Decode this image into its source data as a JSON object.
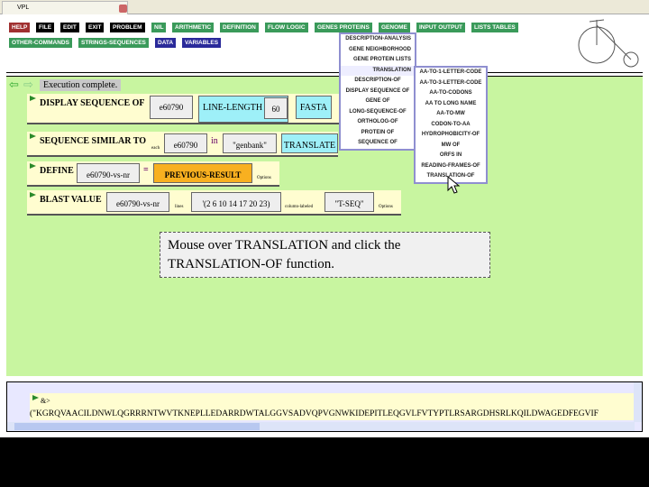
{
  "window": {
    "title": "VPL"
  },
  "toolbar": {
    "row1": [
      {
        "label": "HELP",
        "color": "#a03030"
      },
      {
        "label": "FILE",
        "color": "#000000"
      },
      {
        "label": "EDIT",
        "color": "#000000"
      },
      {
        "label": "EXIT",
        "color": "#000000"
      },
      {
        "label": "PROBLEM",
        "color": "#000000"
      },
      {
        "label": "NIL",
        "color": "#3a9a5a"
      },
      {
        "label": "ARITHMETIC",
        "color": "#3a9a5a"
      },
      {
        "label": "DEFINITION",
        "color": "#3a9a5a"
      },
      {
        "label": "FLOW LOGIC",
        "color": "#3a9a5a"
      },
      {
        "label": "GENES PROTEINS",
        "color": "#3a9a5a"
      },
      {
        "label": "GENOME",
        "color": "#3a9a5a"
      },
      {
        "label": "INPUT OUTPUT",
        "color": "#3a9a5a"
      },
      {
        "label": "LISTS TABLES",
        "color": "#3a9a5a"
      }
    ],
    "row2": [
      {
        "label": "OTHER-COMMANDS",
        "color": "#3a9a5a"
      },
      {
        "label": "STRINGS-SEQUENCES",
        "color": "#3a9a5a"
      },
      {
        "label": "DATA",
        "color": "#2a2a9a"
      },
      {
        "label": "VARIABLES",
        "color": "#2a2a9a"
      }
    ]
  },
  "status": "Execution complete.",
  "commands": {
    "c1": {
      "name": "DISPLAY SEQUENCE OF",
      "arg": "e60790",
      "kw": "LINE-LENGTH",
      "len": "60",
      "fmt": "FASTA"
    },
    "c2": {
      "name": "SEQUENCE SIMILAR TO",
      "each": "each",
      "arg": "e60790",
      "in": "in",
      "db": "\"genbank\"",
      "kw": "TRANSLATE"
    },
    "c3": {
      "name": "DEFINE",
      "var": "e60790-vs-nr",
      "eq": "=",
      "val": "PREVIOUS-RESULT",
      "opt": "Options"
    },
    "c4": {
      "name": "BLAST VALUE",
      "arg": "e60790-vs-nr",
      "lines": "lines",
      "cols": "'(2 6 10 14 17 20 23)",
      "colname": "column-labeled",
      "lbl": "\"T-SEQ\"",
      "opt": "Options"
    }
  },
  "menu": {
    "items": [
      "DESCRIPTION-ANALYSIS",
      "GENE NEIGHBORHOOD",
      "GENE PROTEIN LISTS",
      "TRANSLATION",
      "DESCRIPTION-OF",
      "DISPLAY SEQUENCE OF",
      "GENE OF",
      "LONG-SEQUENCE-OF",
      "ORTHOLOG-OF",
      "PROTEIN OF",
      "SEQUENCE OF"
    ],
    "submenu": [
      "AA-TO-1-LETTER-CODE",
      "AA-TO-3-LETTER-CODE",
      "AA-TO-CODONS",
      "AA TO LONG NAME",
      "AA-TO-MW",
      "CODON-TO-AA",
      "HYDROPHOBICITY-OF",
      "MW OF",
      "ORFS IN",
      "READING-FRAMES-OF",
      "TRANSLATION-OF"
    ]
  },
  "tooltip": "Mouse over TRANSLATION and click the TRANSLATION-OF function.",
  "output": {
    "label": "&>",
    "text": "(\"KGRQVAACILDNWLQGRRRNTWVTKNEPLLEDARRDWTALGGVSADVQPVGNWKIDEPITLEQGVLFVTYPTLRSARGDHSRLKQILDWAGEDFEGVIF"
  }
}
